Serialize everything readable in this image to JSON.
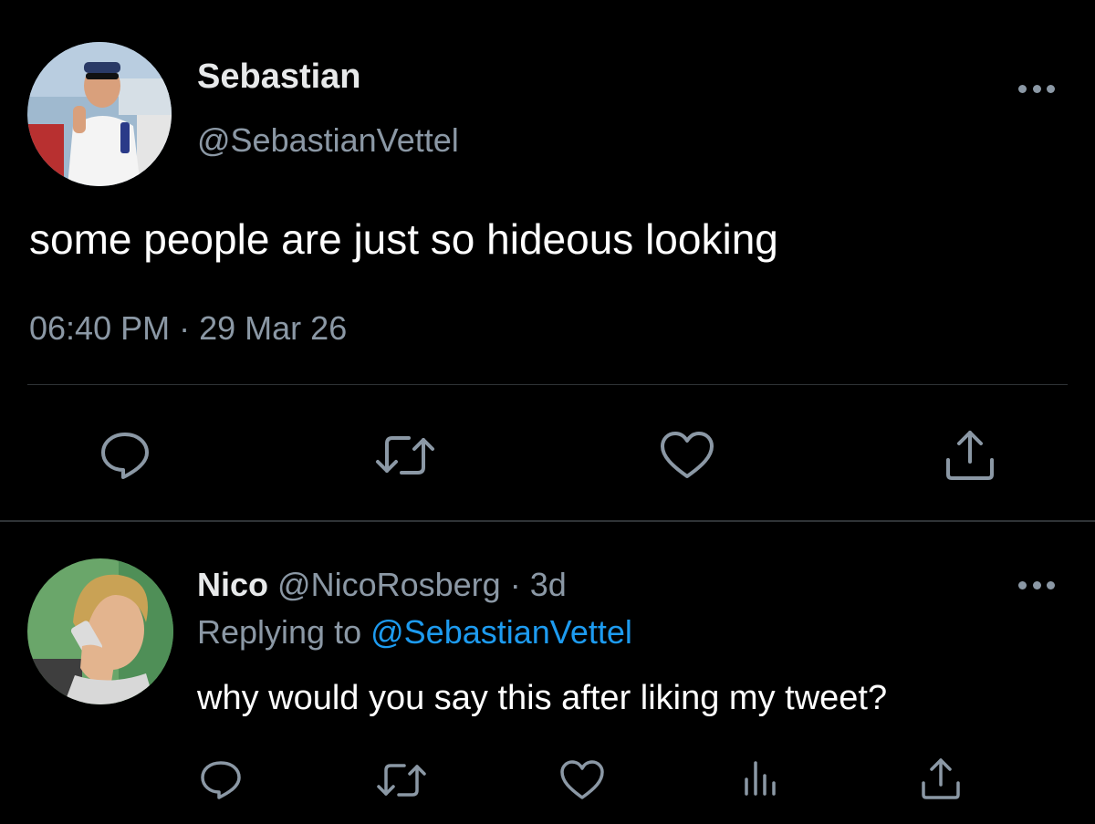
{
  "main_tweet": {
    "display_name": "Sebastian",
    "handle": "@SebastianVettel",
    "text": "some people are just so hideous looking",
    "time": "06:40 PM",
    "separator": "·",
    "date": "29 Mar 26",
    "more_icon": "more-horizontal-icon",
    "actions": {
      "reply_icon": "reply-icon",
      "retweet_icon": "retweet-icon",
      "like_icon": "heart-icon",
      "share_icon": "share-icon"
    }
  },
  "reply_tweet": {
    "display_name": "Nico",
    "handle": "@NicoRosberg",
    "separator": "·",
    "age": "3d",
    "replying_prefix": "Replying to",
    "replying_to": "@SebastianVettel",
    "text": "why would you say this after liking my tweet?",
    "more_icon": "more-horizontal-icon",
    "actions": {
      "reply_icon": "reply-icon",
      "retweet_icon": "retweet-icon",
      "like_icon": "heart-icon",
      "analytics_icon": "analytics-icon",
      "share_icon": "share-icon"
    }
  },
  "colors": {
    "background": "#000000",
    "primary_text": "#ffffff",
    "secondary_text": "#8b98a5",
    "link": "#1d9bf0",
    "divider": "#2f3336"
  }
}
